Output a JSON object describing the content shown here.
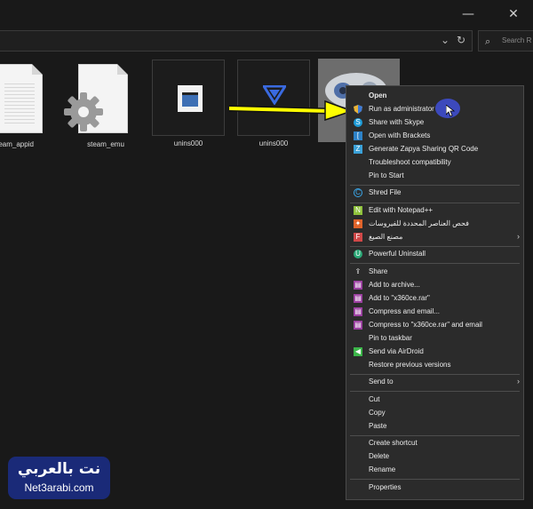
{
  "window": {
    "minimize_icon": "minimize-icon",
    "close_icon": "close-icon"
  },
  "address": {
    "dropdown_icon": "chevron-down-icon",
    "refresh_icon": "refresh-icon"
  },
  "search": {
    "placeholder": "Search R"
  },
  "files": [
    {
      "name": "steam_appid"
    },
    {
      "name": "steam_emu"
    },
    {
      "name": "unins000"
    },
    {
      "name": "unins000"
    },
    {
      "name": ""
    }
  ],
  "context_menu": {
    "items": [
      {
        "label": "Open",
        "bold": true,
        "icon": ""
      },
      {
        "label": "Run as administrator",
        "icon": "shield-icon"
      },
      {
        "label": "Share with Skype",
        "icon": "skype-icon"
      },
      {
        "label": "Open with Brackets",
        "icon": "brackets-icon"
      },
      {
        "label": "Generate Zapya Sharing QR Code",
        "icon": "zapya-icon"
      },
      {
        "label": "Troubleshoot compatibility",
        "icon": ""
      },
      {
        "label": "Pin to Start",
        "icon": ""
      },
      {
        "label": "Shred File",
        "icon": "shred-icon"
      },
      {
        "label": "Edit with Notepad++",
        "icon": "notepadpp-icon"
      },
      {
        "label": "فحص العناصر المحددة للفيروسات",
        "icon": "antivirus-icon"
      },
      {
        "label": "مصنع الصيغ",
        "icon": "format-factory-icon",
        "submenu": true
      },
      {
        "label": "Powerful Uninstall",
        "icon": "uninstall-icon"
      },
      {
        "label": "Share",
        "icon": "share-icon"
      },
      {
        "label": "Add to archive...",
        "icon": "winrar-icon"
      },
      {
        "label": "Add to \"x360ce.rar\"",
        "icon": "winrar-icon"
      },
      {
        "label": "Compress and email...",
        "icon": "winrar-icon"
      },
      {
        "label": "Compress to \"x360ce.rar\" and email",
        "icon": "winrar-icon"
      },
      {
        "label": "Pin to taskbar",
        "icon": ""
      },
      {
        "label": "Send via AirDroid",
        "icon": "airdroid-icon"
      },
      {
        "label": "Restore previous versions",
        "icon": ""
      },
      {
        "label": "Send to",
        "icon": "",
        "submenu": true
      },
      {
        "label": "Cut",
        "icon": ""
      },
      {
        "label": "Copy",
        "icon": ""
      },
      {
        "label": "Paste",
        "icon": ""
      },
      {
        "label": "Create shortcut",
        "icon": ""
      },
      {
        "label": "Delete",
        "icon": ""
      },
      {
        "label": "Rename",
        "icon": ""
      },
      {
        "label": "Properties",
        "icon": ""
      }
    ]
  },
  "watermark": {
    "arabic": "نت بالعربي",
    "english": "Net3arabi.com"
  }
}
